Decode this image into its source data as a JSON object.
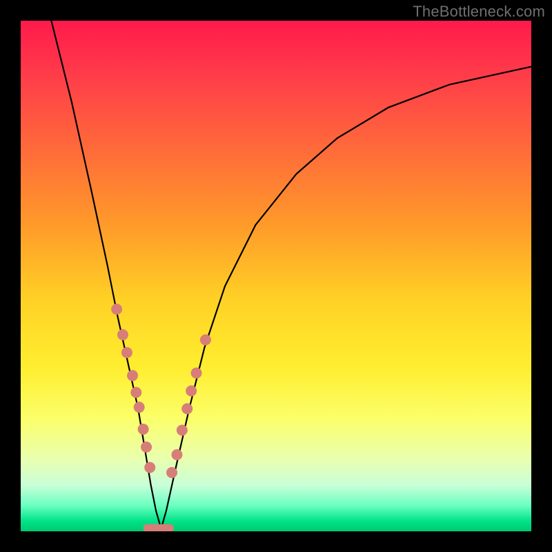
{
  "watermark": "TheBottleneck.com",
  "colors": {
    "dot": "#d77e78",
    "curve": "#000000",
    "frame": "#000000"
  },
  "chart_data": {
    "type": "line",
    "title": "",
    "xlabel": "",
    "ylabel": "",
    "xlim": [
      0,
      100
    ],
    "ylim": [
      0,
      100
    ],
    "note": "Axes are unlabeled in the source image; x/y are in percent of plot width/height with origin at bottom-left. The curve is a V-shaped bottleneck profile that touches 0 near x≈27 and rises steeply on both sides.",
    "series": [
      {
        "name": "bottleneck-curve",
        "x": [
          6,
          10,
          14,
          17,
          19,
          21,
          23,
          24.5,
          25.5,
          26.5,
          27.5,
          28.5,
          30.5,
          33,
          36,
          40,
          46,
          54,
          62,
          72,
          84,
          100
        ],
        "y": [
          100,
          84,
          66,
          52,
          42,
          33,
          24,
          15,
          9,
          4,
          0.5,
          4,
          13,
          24,
          36,
          48,
          60,
          70,
          77,
          83,
          87.5,
          91
        ]
      }
    ],
    "markers": {
      "name": "highlighted-points",
      "comment": "Salmon dots clustered near the valley on both arms plus a capsule at the very bottom.",
      "x": [
        18.8,
        20.0,
        20.8,
        21.9,
        22.6,
        23.2,
        24.0,
        24.6,
        25.3,
        29.6,
        30.6,
        31.6,
        32.6,
        33.4,
        34.4,
        36.2
      ],
      "y": [
        43.5,
        38.5,
        35.0,
        30.5,
        27.2,
        24.3,
        20.0,
        16.5,
        12.5,
        11.5,
        15.0,
        19.8,
        24.0,
        27.5,
        31.0,
        37.5
      ]
    },
    "trough_capsule": {
      "x_center": 27.0,
      "y_center": 0.6,
      "width": 6.0,
      "height": 1.6
    }
  }
}
